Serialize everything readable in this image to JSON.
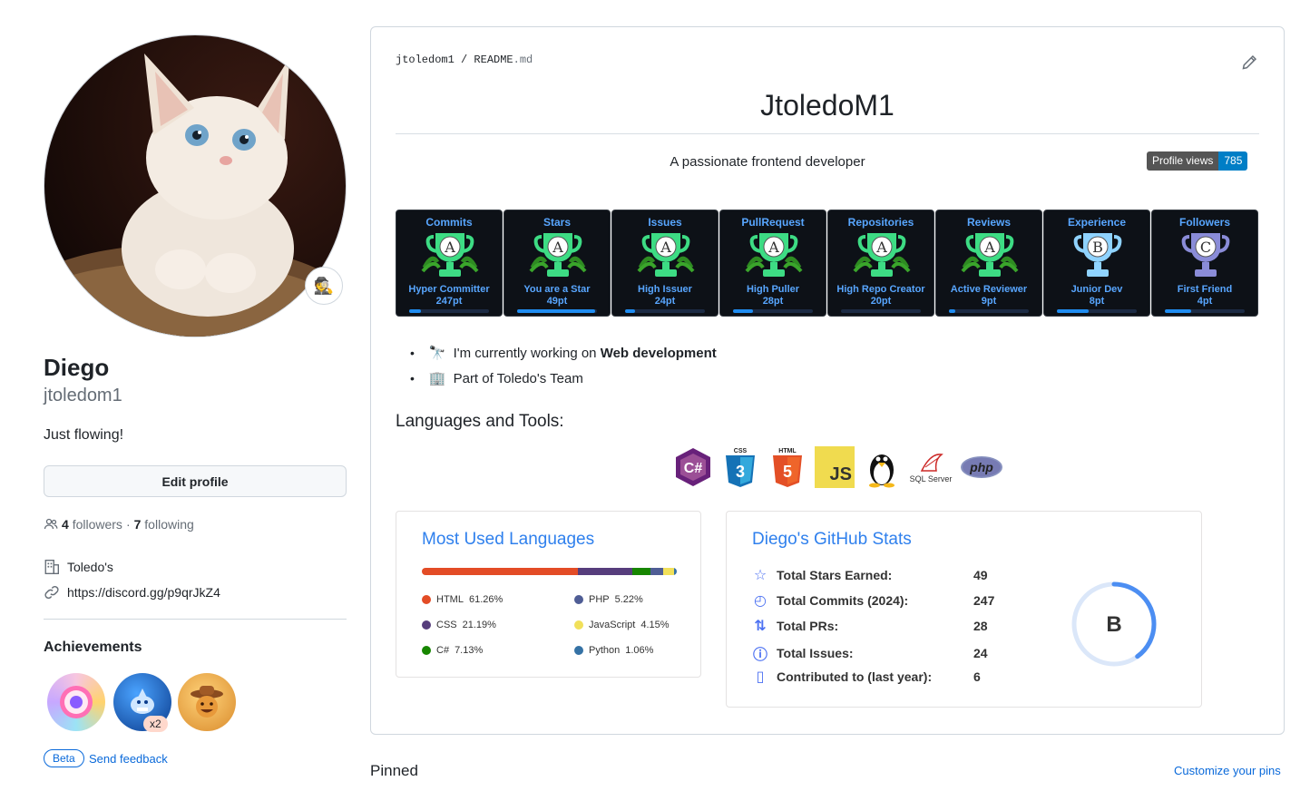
{
  "profile": {
    "name": "Diego",
    "login": "jtoledom1",
    "bio": "Just flowing!",
    "edit_label": "Edit profile",
    "followers_count": "4",
    "followers_label": "followers",
    "separator": "·",
    "following_count": "7",
    "following_label": "following",
    "company": "Toledo's",
    "link": "https://discord.gg/p9qrJkZ4",
    "achievements_title": "Achievements",
    "achievement_multiplier": "x2",
    "beta_label": "Beta",
    "feedback_label": "Send feedback"
  },
  "readme": {
    "owner": "jtoledom1",
    "slash": "/",
    "file_name": "README",
    "file_ext": ".md",
    "title": "JtoledoM1",
    "tagline": "A passionate frontend developer",
    "views_label": "Profile views",
    "views_count": "785",
    "bullet1_prefix": "I'm currently working on",
    "bullet1_strong": "Web development",
    "bullet2": "Part of Toledo's Team",
    "tools_title": "Languages and Tools:",
    "tools": [
      "C#",
      "CSS",
      "HTML",
      "JS",
      "Linux",
      "SQL Server",
      "php"
    ]
  },
  "trophies": [
    {
      "title": "Commits",
      "rank": "A",
      "subtitle": "Hyper Committer",
      "points": "247pt",
      "progress": 0.15
    },
    {
      "title": "Stars",
      "rank": "A",
      "subtitle": "You are a Star",
      "points": "49pt",
      "progress": 0.98
    },
    {
      "title": "Issues",
      "rank": "A",
      "subtitle": "High Issuer",
      "points": "24pt",
      "progress": 0.12
    },
    {
      "title": "PullRequest",
      "rank": "A",
      "subtitle": "High Puller",
      "points": "28pt",
      "progress": 0.25
    },
    {
      "title": "Repositories",
      "rank": "A",
      "subtitle": "High Repo Creator",
      "points": "20pt",
      "progress": 0.0
    },
    {
      "title": "Reviews",
      "rank": "A",
      "subtitle": "Active Reviewer",
      "points": "9pt",
      "progress": 0.08
    },
    {
      "title": "Experience",
      "rank": "B",
      "subtitle": "Junior Dev",
      "points": "8pt",
      "progress": 0.4
    },
    {
      "title": "Followers",
      "rank": "C",
      "subtitle": "First Friend",
      "points": "4pt",
      "progress": 0.33
    }
  ],
  "languages": {
    "title": "Most Used Languages",
    "items": [
      {
        "name": "HTML",
        "percent": "61.26%",
        "value": 61.26,
        "color": "#e34c26"
      },
      {
        "name": "CSS",
        "percent": "21.19%",
        "value": 21.19,
        "color": "#563d7c"
      },
      {
        "name": "C#",
        "percent": "7.13%",
        "value": 7.13,
        "color": "#178600"
      },
      {
        "name": "PHP",
        "percent": "5.22%",
        "value": 5.22,
        "color": "#4F5D95"
      },
      {
        "name": "JavaScript",
        "percent": "4.15%",
        "value": 4.15,
        "color": "#f1e05a"
      },
      {
        "name": "Python",
        "percent": "1.06%",
        "value": 1.06,
        "color": "#3572A5"
      }
    ]
  },
  "stats": {
    "title": "Diego's GitHub Stats",
    "rows": [
      {
        "label": "Total Stars Earned:",
        "value": "49"
      },
      {
        "label": "Total Commits (2024):",
        "value": "247"
      },
      {
        "label": "Total PRs:",
        "value": "28"
      },
      {
        "label": "Total Issues:",
        "value": "24"
      },
      {
        "label": "Contributed to (last year):",
        "value": "6"
      }
    ],
    "grade": "B",
    "grade_progress": 0.4
  },
  "pinned": {
    "title": "Pinned",
    "customize_label": "Customize your pins"
  },
  "colors": {
    "accent": "#0969da",
    "trophy_title": "#58a6ff",
    "stats_title": "#2f80ed",
    "trophy_bg": "#0d1117"
  }
}
